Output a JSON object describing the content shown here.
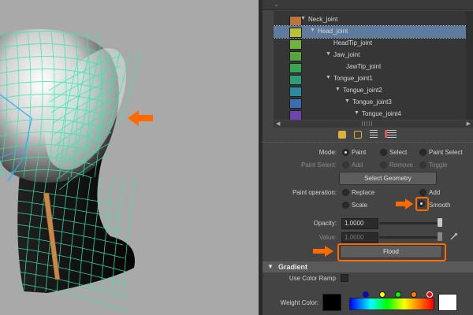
{
  "outliner": {
    "joints": [
      {
        "label": "Neck_joint",
        "color": "#b8763a",
        "arrow": "▼",
        "selected": false
      },
      {
        "label": "Head_joint",
        "color": "#b8c038",
        "arrow": "▼",
        "selected": true
      },
      {
        "label": "HeadTip_joint",
        "color": "#6fb33f",
        "arrow": "",
        "selected": false
      },
      {
        "label": "Jaw_joint",
        "color": "#58a43f",
        "arrow": "▼",
        "selected": false
      },
      {
        "label": "JawTip_joint",
        "color": "#3aa455",
        "arrow": "",
        "selected": false
      },
      {
        "label": "Tongue_joint1",
        "color": "#2f9d76",
        "arrow": "▼",
        "selected": false
      },
      {
        "label": "Tongue_joint2",
        "color": "#2a8b9f",
        "arrow": "▼",
        "selected": false
      },
      {
        "label": "Tongue_joint3",
        "color": "#3b6eb0",
        "arrow": "▼",
        "selected": false
      },
      {
        "label": "Tongue_joint4",
        "color": "#6d44b0",
        "arrow": "▼",
        "selected": false
      }
    ]
  },
  "paint": {
    "mode_label": "Mode:",
    "mode_paint": "Paint",
    "mode_select": "Select",
    "mode_paint_select": "Paint Select",
    "paint_select_label": "Paint Select:",
    "ps_add": "Add",
    "ps_remove": "Remove",
    "ps_toggle": "Toggle",
    "select_geometry": "Select Geometry",
    "op_label": "Paint operation:",
    "op_replace": "Replace",
    "op_add": "Add",
    "op_scale": "Scale",
    "op_smooth": "Smooth",
    "opacity_label": "Opacity:",
    "opacity_value": "1.0000",
    "value_label": "Value:",
    "value_value": "1.0000",
    "flood": "Flood"
  },
  "gradient": {
    "header": "Gradient",
    "use_color_ramp": "Use Color Ramp",
    "weight_color": "Weight Color:"
  },
  "colors": {
    "accent": "#ff6a00",
    "wire": "#35e6b0",
    "selection": "#5e7a9d"
  }
}
